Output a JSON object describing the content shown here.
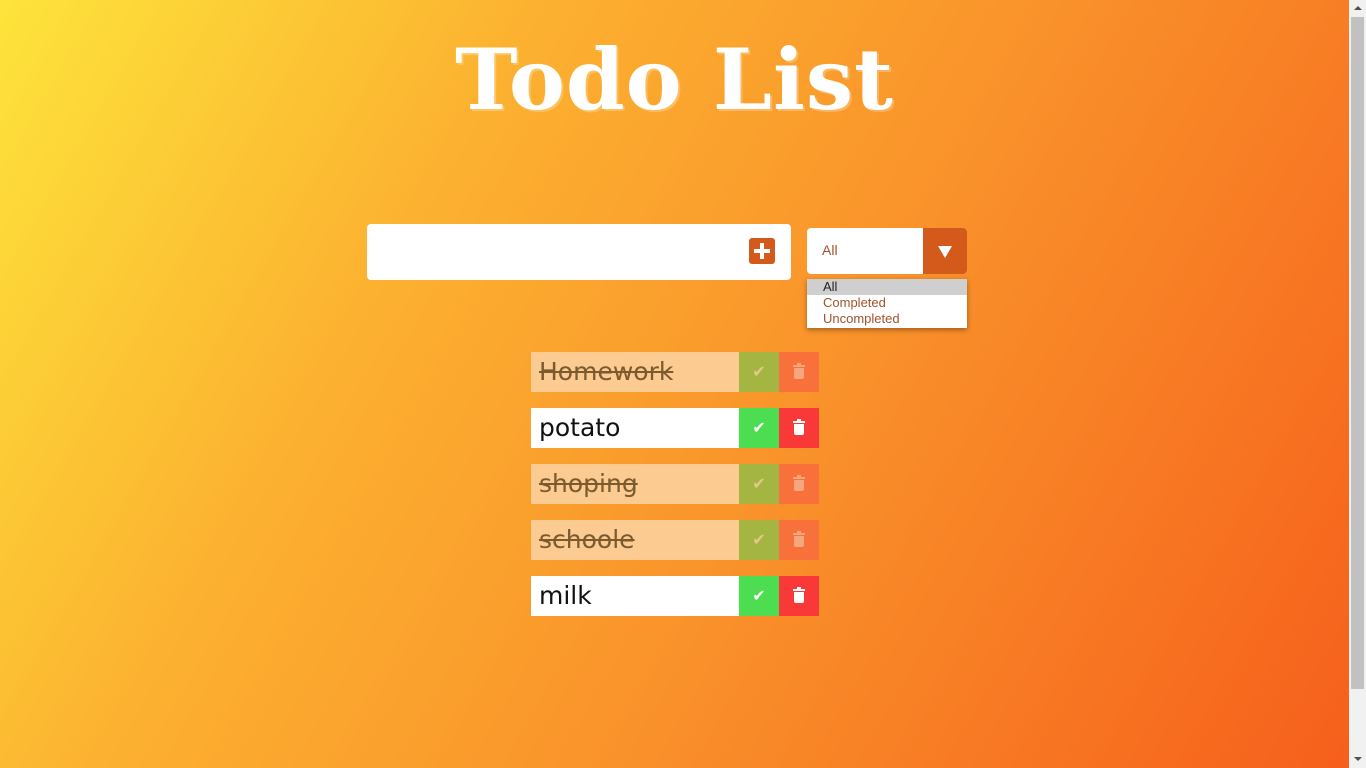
{
  "header": {
    "title": "Todo List"
  },
  "form": {
    "input_value": "",
    "add_icon": "plus-square-icon",
    "filter": {
      "selected": "All",
      "options": [
        "All",
        "Completed",
        "Uncompleted"
      ],
      "expanded": true
    }
  },
  "todos": [
    {
      "text": "Homework",
      "completed": true
    },
    {
      "text": "potato",
      "completed": false
    },
    {
      "text": "shoping",
      "completed": true
    },
    {
      "text": "schoole",
      "completed": true
    },
    {
      "text": "milk",
      "completed": false
    }
  ],
  "icons": {
    "check": "check-icon",
    "delete": "trash-icon"
  },
  "colors": {
    "accent": "#d35a1a",
    "check_active": "#4cde50",
    "delete_active": "#f93838",
    "completed_item_bg": "#fbcb92"
  }
}
